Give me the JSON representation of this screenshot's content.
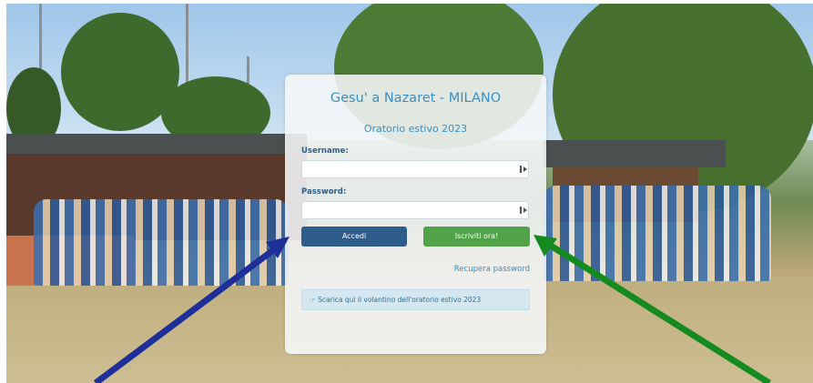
{
  "login": {
    "title": "Gesu' a Nazaret - MILANO",
    "subtitle": "Oratorio estivo 2023",
    "username_label": "Username:",
    "username_value": "",
    "password_label": "Password:",
    "password_value": "",
    "login_button": "Accedi",
    "signup_button": "Iscriviti ora!",
    "recover_link": "Recupera password",
    "flyer_link": "Scarica qui il volantino dell'oratorio estivo 2023"
  },
  "colors": {
    "accent_blue": "#3b8ec0",
    "login_button": "#2f5d8b",
    "signup_button": "#52a24a",
    "left_arrow": "#1f2f9a",
    "right_arrow": "#158a1f"
  },
  "icons": {
    "field_icon": "key-icon",
    "flyer_icon": "pointing-hand-icon"
  }
}
